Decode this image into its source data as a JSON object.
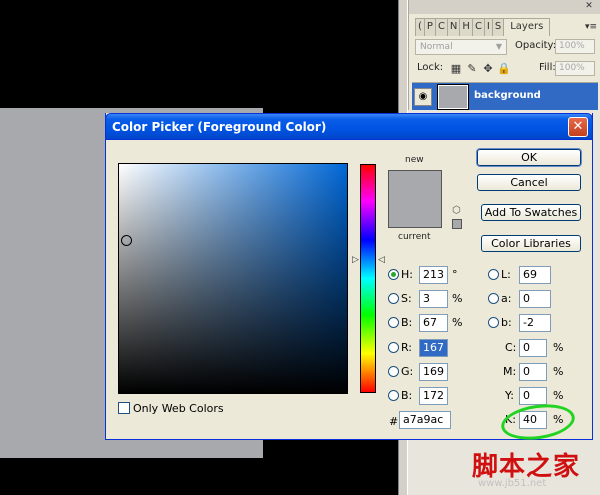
{
  "layers_panel": {
    "tabs": [
      "(",
      "P",
      "C",
      "N",
      "H",
      "C",
      "I",
      "S"
    ],
    "active_tab": "Layers",
    "blend_mode": "Normal",
    "opacity_label": "Opacity:",
    "opacity_value": "100%",
    "lock_label": "Lock:",
    "fill_label": "Fill:",
    "fill_value": "100%",
    "layer_name": "background"
  },
  "dialog": {
    "title": "Color Picker (Foreground Color)",
    "new_label": "new",
    "current_label": "current",
    "buttons": {
      "ok": "OK",
      "cancel": "Cancel",
      "add_to_swatches": "Add To Swatches",
      "color_libraries": "Color Libraries"
    },
    "fields": {
      "H": {
        "label": "H:",
        "value": "213",
        "unit": "°"
      },
      "S": {
        "label": "S:",
        "value": "3",
        "unit": "%"
      },
      "B": {
        "label": "B:",
        "value": "67",
        "unit": "%"
      },
      "R": {
        "label": "R:",
        "value": "167"
      },
      "G": {
        "label": "G:",
        "value": "169"
      },
      "Bl": {
        "label": "B:",
        "value": "172"
      },
      "L": {
        "label": "L:",
        "value": "69"
      },
      "a": {
        "label": "a:",
        "value": "0"
      },
      "b": {
        "label": "b:",
        "value": "-2"
      },
      "C": {
        "label": "C:",
        "value": "0",
        "unit": "%"
      },
      "M": {
        "label": "M:",
        "value": "0",
        "unit": "%"
      },
      "Y": {
        "label": "Y:",
        "value": "0",
        "unit": "%"
      },
      "K": {
        "label": "K:",
        "value": "40",
        "unit": "%"
      }
    },
    "hex_label": "#",
    "hex_value": "a7a9ac",
    "only_web_colors": "Only Web Colors"
  },
  "colors": {
    "selected_color": "#a7a9ac",
    "title_bar": "#0054e3",
    "highlight_circle": "#22d422"
  },
  "watermark": {
    "site_name": "脚本之家",
    "url": "www.jb51.net"
  }
}
